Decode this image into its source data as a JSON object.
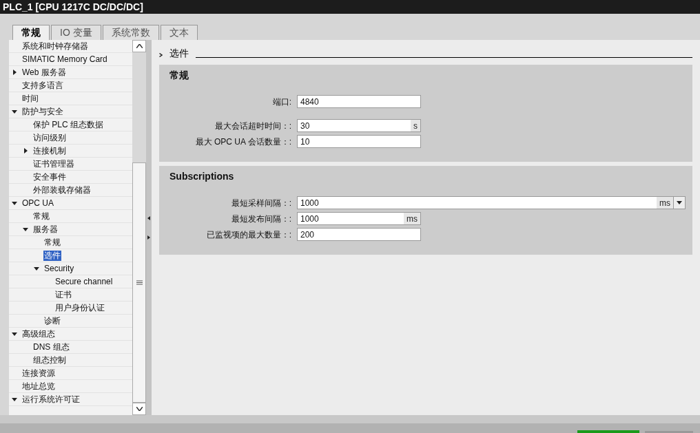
{
  "window": {
    "title": "PLC_1 [CPU 1217C DC/DC/DC]"
  },
  "tabs": [
    {
      "label": "常规",
      "selected": true
    },
    {
      "label": "IO 变量",
      "selected": false
    },
    {
      "label": "系统常数",
      "selected": false
    },
    {
      "label": "文本",
      "selected": false
    }
  ],
  "tree": [
    {
      "label": "系统和时钟存储器",
      "selected": false
    },
    {
      "label": "SIMATIC Memory Card",
      "selected": false
    },
    {
      "label": "Web 服务器",
      "selected": false,
      "expanded": false
    },
    {
      "label": "支持多语言",
      "selected": false
    },
    {
      "label": "时间",
      "selected": false
    },
    {
      "label": "防护与安全",
      "selected": false,
      "expanded": true,
      "children": [
        {
          "label": "保护 PLC 组态数据",
          "selected": false
        },
        {
          "label": "访问级别",
          "selected": false
        },
        {
          "label": "连接机制",
          "selected": false,
          "expanded": false
        },
        {
          "label": "证书管理器",
          "selected": false
        },
        {
          "label": "安全事件",
          "selected": false
        },
        {
          "label": "外部装载存储器",
          "selected": false
        }
      ]
    },
    {
      "label": "OPC UA",
      "selected": false,
      "expanded": true,
      "children": [
        {
          "label": "常规",
          "selected": false
        },
        {
          "label": "服务器",
          "selected": false,
          "expanded": true,
          "children": [
            {
              "label": "常规",
              "selected": false
            },
            {
              "label": "选件",
              "selected": true
            },
            {
              "label": "Security",
              "selected": false,
              "expanded": true,
              "children": [
                {
                  "label": "Secure channel",
                  "selected": false
                },
                {
                  "label": "证书",
                  "selected": false
                },
                {
                  "label": "用户身份认证",
                  "selected": false
                }
              ]
            },
            {
              "label": "诊断",
              "selected": false
            }
          ]
        }
      ]
    },
    {
      "label": "高级组态",
      "selected": false,
      "expanded": true,
      "children": [
        {
          "label": "DNS 组态",
          "selected": false
        },
        {
          "label": "组态控制",
          "selected": false
        }
      ]
    },
    {
      "label": "连接资源",
      "selected": false
    },
    {
      "label": "地址总览",
      "selected": false
    },
    {
      "label": "运行系统许可证",
      "selected": false,
      "expanded": true
    }
  ],
  "content": {
    "heading": "选件",
    "sections": [
      {
        "title": "常规",
        "groups": [
          [
            {
              "label": "端口:",
              "value": "4840",
              "kind": "text"
            }
          ],
          [
            {
              "label": "最大会话超时时间：:",
              "value": "30",
              "kind": "unit",
              "unit": "s"
            },
            {
              "label": "最大 OPC UA 会话数量：:",
              "value": "10",
              "kind": "text"
            }
          ]
        ]
      },
      {
        "title": "Subscriptions",
        "groups": [
          [
            {
              "label": "最短采样间隔：:",
              "value": "1000",
              "kind": "dropdown",
              "unit": "ms"
            },
            {
              "label": "最短发布间隔：:",
              "value": "1000",
              "kind": "unit",
              "unit": "ms"
            },
            {
              "label": "已监视项的最大数量：:",
              "value": "200",
              "kind": "text"
            }
          ]
        ]
      }
    ]
  }
}
